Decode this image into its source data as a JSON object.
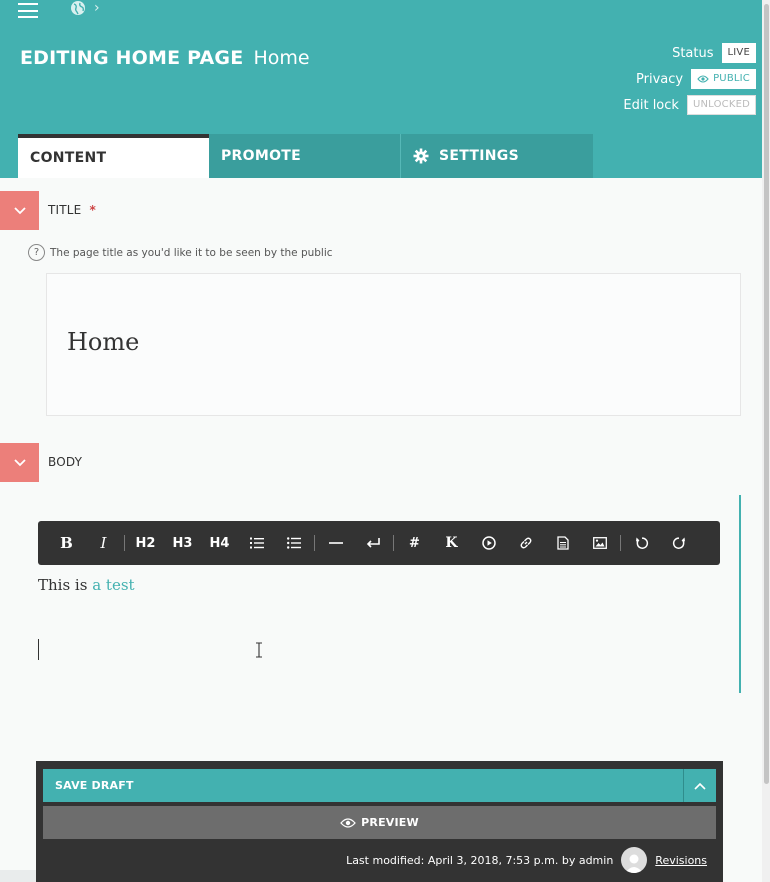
{
  "header": {
    "title_strong": "EDITING HOME PAGE",
    "title_light": "Home",
    "status_label": "Status",
    "status_value": "LIVE",
    "privacy_label": "Privacy",
    "privacy_value": "PUBLIC",
    "lock_label": "Edit lock",
    "lock_value": "UNLOCKED"
  },
  "tabs": [
    {
      "label": "CONTENT"
    },
    {
      "label": "PROMOTE"
    },
    {
      "label": "SETTINGS"
    }
  ],
  "title_section": {
    "label": "TITLE",
    "required_mark": "*",
    "help_icon": "?",
    "help_text": "The page title as you'd like it to be seen by the public",
    "value": "Home"
  },
  "body_section": {
    "label": "BODY",
    "text_before": "This is ",
    "link_text": "a test"
  },
  "toolbar": {
    "bold": "B",
    "italic": "I",
    "h2": "H2",
    "h3": "H3",
    "h4": "H4",
    "anchor": "#",
    "kbd": "K"
  },
  "footer": {
    "save_draft": "SAVE DRAFT",
    "preview": "PREVIEW",
    "last_modified": "Last modified: April 3, 2018, 7:53 p.m. by admin",
    "revisions": "Revisions"
  },
  "colors": {
    "primary": "#43b1b0",
    "toggle": "#ec7f7a",
    "dark": "#333333"
  }
}
